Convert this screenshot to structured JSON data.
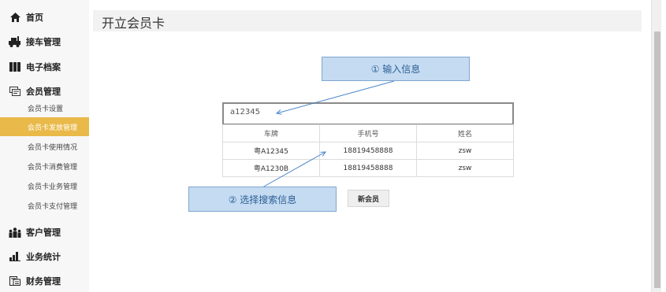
{
  "sidebar": {
    "items": [
      {
        "label": "首页",
        "icon": "home-icon"
      },
      {
        "label": "接车管理",
        "icon": "car-icon"
      },
      {
        "label": "电子档案",
        "icon": "archive-icon"
      },
      {
        "label": "会员管理",
        "icon": "member-card-icon"
      },
      {
        "label": "客户管理",
        "icon": "users-icon"
      },
      {
        "label": "业务统计",
        "icon": "bar-chart-icon"
      },
      {
        "label": "财务管理",
        "icon": "finance-icon"
      }
    ],
    "submenu": [
      {
        "label": "会员卡设置",
        "active": false
      },
      {
        "label": "会员卡发放管理",
        "active": true
      },
      {
        "label": "会员卡使用情况",
        "active": false
      },
      {
        "label": "会员卡消费管理",
        "active": false
      },
      {
        "label": "会员卡业务管理",
        "active": false
      },
      {
        "label": "会员卡支付管理",
        "active": false
      }
    ]
  },
  "page": {
    "title": "开立会员卡"
  },
  "search": {
    "value": "a12345"
  },
  "table": {
    "headers": [
      "车牌",
      "手机号",
      "姓名"
    ],
    "rows": [
      [
        "粤A12345",
        "18819458888",
        "zsw"
      ],
      [
        "粤A1230B",
        "18819458888",
        "zsw"
      ]
    ]
  },
  "buttons": {
    "new_member": "新会员"
  },
  "callouts": {
    "step1": "① 输入信息",
    "step2": "② 选择搜索信息"
  },
  "colors": {
    "active_menu": "#e9b949",
    "callout_fill": "#c5dbf1",
    "callout_text": "#2b5f96",
    "arrow": "#4a86c8"
  }
}
